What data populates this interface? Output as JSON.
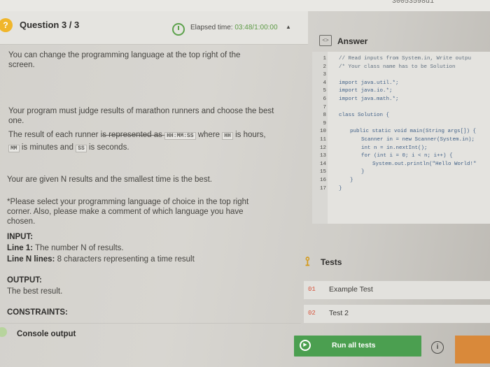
{
  "header": {
    "question_label": "Question 3 / 3",
    "elapsed_label": "Elapsed time:",
    "elapsed_value": "03:48/1:00:00",
    "caret": "▲",
    "top_serial": "30053598d1"
  },
  "statement": {
    "p1": "You can change the programming language at the top right of the screen.",
    "p2": "Your program must judge results of marathon runners and choose the best one.",
    "p3_a": "The result of each runner is represented as",
    "p3_code": "HH:MM:SS",
    "p3_b": "where",
    "p3_hh": "HH",
    "p3_c": "is hours,",
    "p3_mm": "MM",
    "p3_d": "is minutes and",
    "p3_ss": "SS",
    "p3_e": "is seconds.",
    "p4": "Your are given N results and the smallest time is the best.",
    "p5": "*Please select your programming language of choice in the top right corner. Also, please make a comment of which language you have chosen."
  },
  "io": {
    "input_label": "INPUT:",
    "line1_label": "Line 1:",
    "line1_text": "The number N of results.",
    "linen_label": "Line N lines:",
    "linen_text": "8 characters representing a time result",
    "output_label": "OUTPUT:",
    "output_text": "The best result.",
    "constraints_label": "CONSTRAINTS:"
  },
  "console": {
    "label": "Console output"
  },
  "answer": {
    "title": "Answer",
    "icon_glyph": "<>",
    "lines": [
      {
        "n": "1",
        "code": "// Read inputs from System.in, Write outpu",
        "type": "comment",
        "indent": 0
      },
      {
        "n": "2",
        "code": "/* Your class name has to be Solution",
        "type": "comment",
        "indent": 0
      },
      {
        "n": "3",
        "code": "",
        "type": "code",
        "indent": 0
      },
      {
        "n": "4",
        "code": "import java.util.*;",
        "type": "code",
        "indent": 0
      },
      {
        "n": "5",
        "code": "import java.io.*;",
        "type": "code",
        "indent": 0
      },
      {
        "n": "6",
        "code": "import java.math.*;",
        "type": "code",
        "indent": 0
      },
      {
        "n": "7",
        "code": "",
        "type": "code",
        "indent": 0
      },
      {
        "n": "8",
        "code": "class Solution {",
        "type": "code",
        "indent": 0
      },
      {
        "n": "9",
        "code": "",
        "type": "code",
        "indent": 0
      },
      {
        "n": "10",
        "code": "public static void main(String args[]) {",
        "type": "code",
        "indent": 1
      },
      {
        "n": "11",
        "code": "Scanner in = new Scanner(System.in);",
        "type": "code",
        "indent": 2
      },
      {
        "n": "12",
        "code": "int n = in.nextInt();",
        "type": "code",
        "indent": 2
      },
      {
        "n": "13",
        "code": "for (int i = 0; i < n; i++) {",
        "type": "code",
        "indent": 2
      },
      {
        "n": "14",
        "code": "System.out.println(\"Hello World!\"",
        "type": "code",
        "indent": 3
      },
      {
        "n": "15",
        "code": "}",
        "type": "code",
        "indent": 2
      },
      {
        "n": "16",
        "code": "}",
        "type": "code",
        "indent": 1
      },
      {
        "n": "17",
        "code": "}",
        "type": "code",
        "indent": 0
      }
    ]
  },
  "tests": {
    "title": "Tests",
    "items": [
      {
        "num": "01",
        "name": "Example Test"
      },
      {
        "num": "02",
        "name": "Test 2"
      }
    ],
    "run_label": "Run all tests",
    "info_glyph": "i"
  },
  "colors": {
    "accent_green": "#4b9f50",
    "question_icon": "#f0b62b",
    "test_number": "#d6533b",
    "code_blue": "#3f5f86"
  }
}
